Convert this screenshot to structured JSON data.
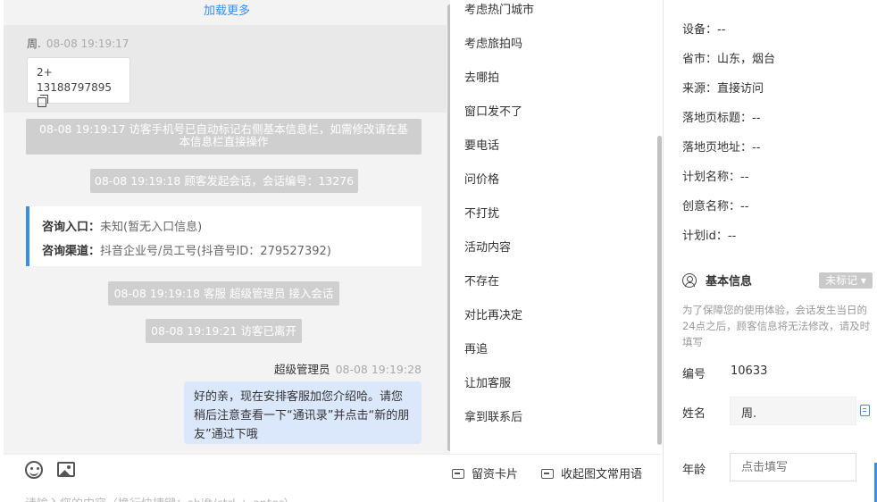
{
  "chat": {
    "load_more": "加载更多",
    "first_message": {
      "sender": "周.",
      "time": "08-08 19:19:17",
      "line1": "2+",
      "line2": "13188797895"
    },
    "system_messages": [
      "08-08 19:19:17 访客手机号已自动标记右侧基本信息栏，如需修改请在基本信息栏直接操作",
      "08-08 19:19:18 顾客发起会话，会话编号：13276",
      "08-08 19:19:18 客服 超级管理员 接入会话",
      "08-08 19:19:21 访客已离开"
    ],
    "consult": {
      "entry_label": "咨询入口：",
      "entry_value": "未知(暂无入口信息)",
      "channel_label": "咨询渠道：",
      "channel_value": "抖音企业号/员工号(抖音号ID：279527392)"
    },
    "agent_message": {
      "sender": "超级管理员",
      "time": "08-08 19:19:28",
      "text": "好的亲，现在安排客服加您介绍哈。请您稍后注意查看一下“通讯录”并点击“新的朋友”通过下哦"
    }
  },
  "input": {
    "placeholder": "请输入您的内容（换行快捷键：shift/ctrl + enter）",
    "leave_card": "留资卡片",
    "collapse_phrases": "收起图文常用语"
  },
  "phrases": [
    "考虑热门城市",
    "考虑旅拍吗",
    "去哪拍",
    "窗口发不了",
    "要电话",
    "问价格",
    "不打扰",
    "活动内容",
    "不存在",
    "对比再决定",
    "再追",
    "让加客服",
    "拿到联系后"
  ],
  "info": {
    "fields": [
      {
        "label": "设备：",
        "value": "--"
      },
      {
        "label": "省市：",
        "value": "山东，烟台"
      },
      {
        "label": "来源：",
        "value": "直接访问"
      },
      {
        "label": "落地页标题：",
        "value": "--"
      },
      {
        "label": "落地页地址：",
        "value": "--"
      },
      {
        "label": "计划名称：",
        "value": "--"
      },
      {
        "label": "创意名称：",
        "value": "--"
      },
      {
        "label": "计划id：",
        "value": "--"
      }
    ],
    "basic_title": "基本信息",
    "tag_button": "未标记",
    "notice": "为了保障您的使用体验，会话发生当日的24点之后，顾客信息将无法修改，请及时填写",
    "id_label": "编号",
    "id_value": "10633",
    "name_label": "姓名",
    "name_value": "周.",
    "age_label": "年龄",
    "age_placeholder": "点击填写"
  }
}
